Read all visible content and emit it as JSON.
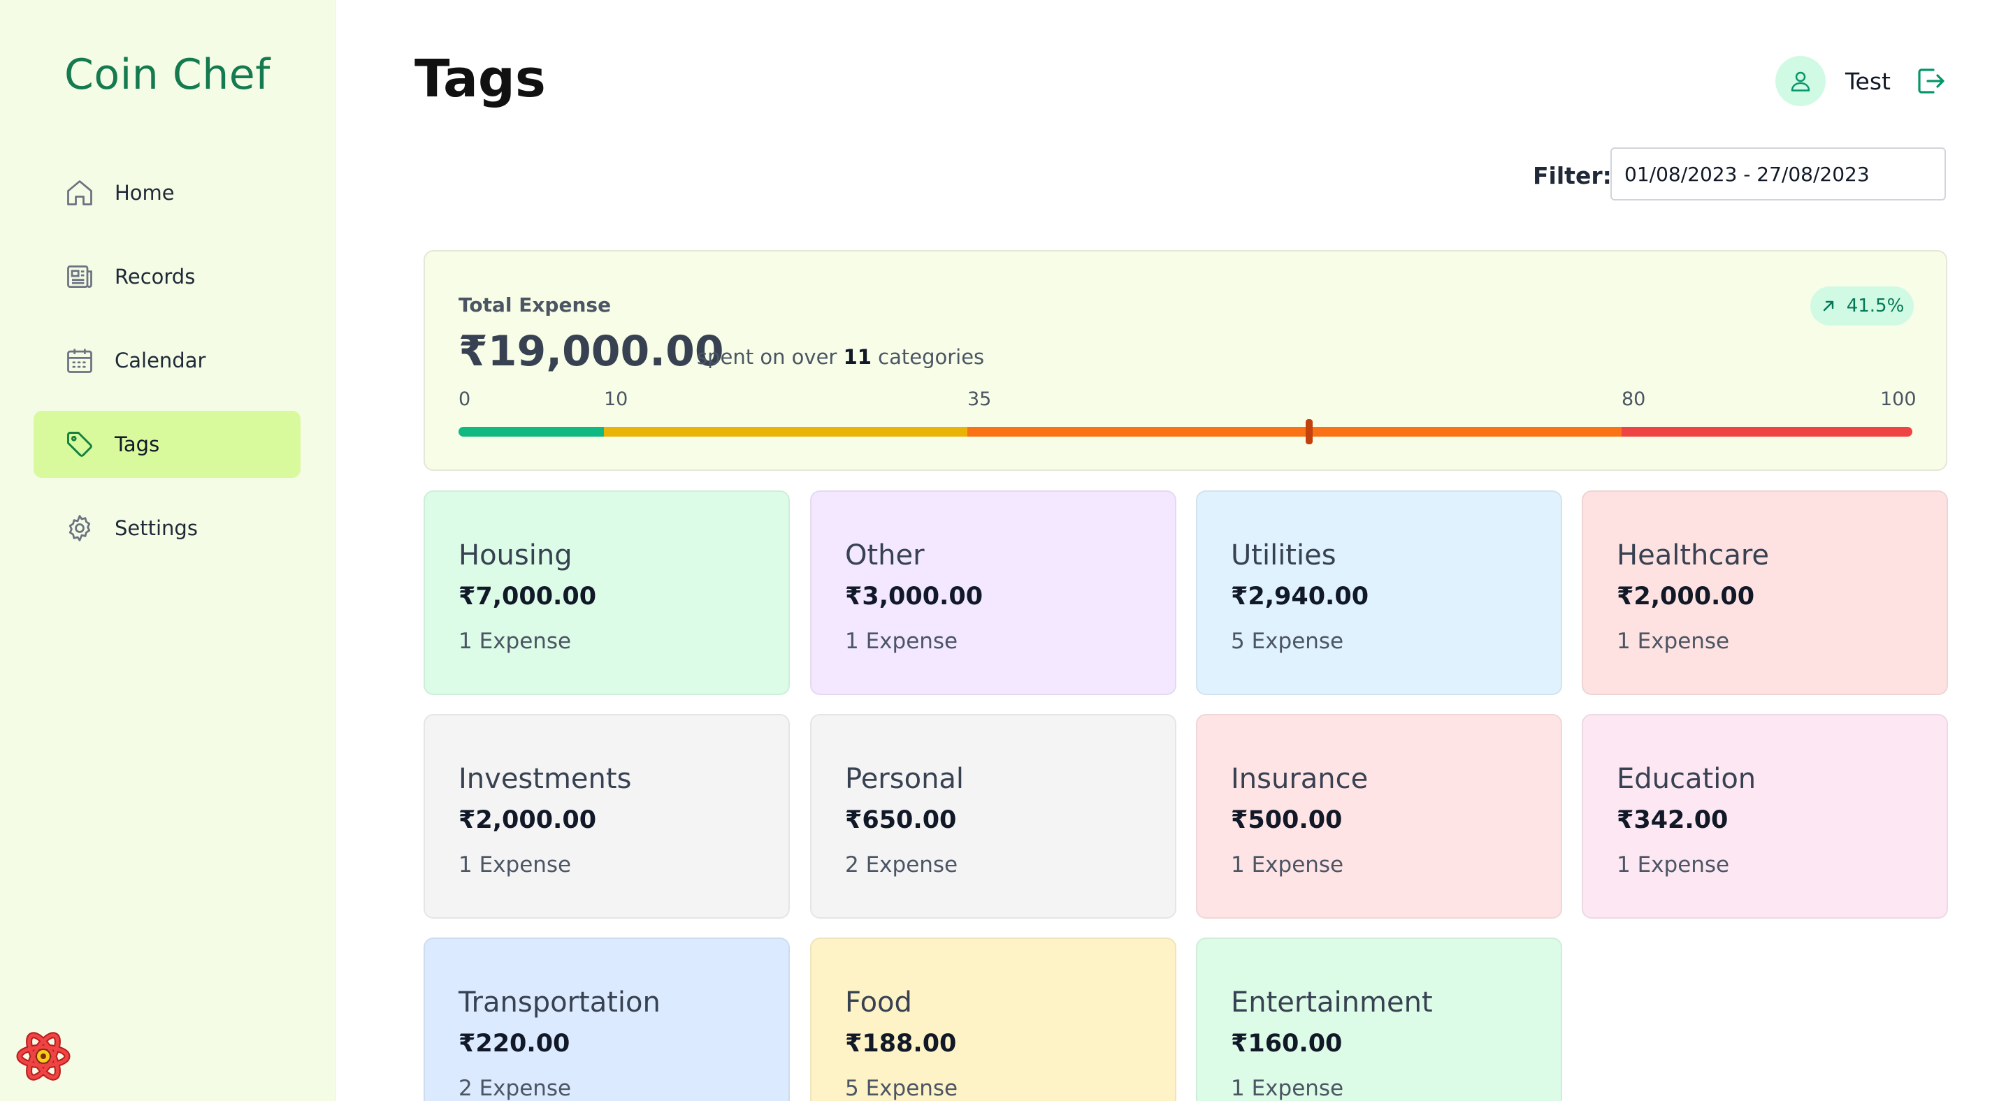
{
  "app": {
    "title": "Coin Chef"
  },
  "sidebar": {
    "items": [
      {
        "label": "Home",
        "icon": "home-icon"
      },
      {
        "label": "Records",
        "icon": "newspaper-icon"
      },
      {
        "label": "Calendar",
        "icon": "calendar-icon"
      },
      {
        "label": "Tags",
        "icon": "tag-icon",
        "active": true
      },
      {
        "label": "Settings",
        "icon": "gear-icon"
      }
    ]
  },
  "header": {
    "title": "Tags",
    "user_name": "Test",
    "filter_label": "Filter:",
    "filter_value": "01/08/2023 - 27/08/2023"
  },
  "summary": {
    "label": "Total Expense",
    "amount": "₹19,000.00",
    "sub_prefix": "spent on over",
    "category_count": "11",
    "sub_suffix": "categories",
    "change": "41.5%",
    "scale": [
      "0",
      "10",
      "35",
      "80",
      "100"
    ],
    "marker_value": 58.5,
    "colors": {
      "green": "#10b981",
      "yellow": "#eab308",
      "orange": "#f97316",
      "red": "#ef4444"
    }
  },
  "tags": [
    {
      "name": "Housing",
      "amount": "₹7,000.00",
      "count": "1 Expense",
      "color": "#dcfce7"
    },
    {
      "name": "Other",
      "amount": "₹3,000.00",
      "count": "1 Expense",
      "color": "#f3e8ff"
    },
    {
      "name": "Utilities",
      "amount": "₹2,940.00",
      "count": "5 Expense",
      "color": "#e0f2fe"
    },
    {
      "name": "Healthcare",
      "amount": "₹2,000.00",
      "count": "1 Expense",
      "color": "#fee2e2"
    },
    {
      "name": "Investments",
      "amount": "₹2,000.00",
      "count": "1 Expense",
      "color": "#f4f4f5"
    },
    {
      "name": "Personal",
      "amount": "₹650.00",
      "count": "2 Expense",
      "color": "#f4f4f5"
    },
    {
      "name": "Insurance",
      "amount": "₹500.00",
      "count": "1 Expense",
      "color": "#ffe4e6"
    },
    {
      "name": "Education",
      "amount": "₹342.00",
      "count": "1 Expense",
      "color": "#fce7f3"
    },
    {
      "name": "Transportation",
      "amount": "₹220.00",
      "count": "2 Expense",
      "color": "#dbeafe"
    },
    {
      "name": "Food",
      "amount": "₹188.00",
      "count": "5 Expense",
      "color": "#fef3c7"
    },
    {
      "name": "Entertainment",
      "amount": "₹160.00",
      "count": "1 Expense",
      "color": "#dcfce7"
    }
  ]
}
